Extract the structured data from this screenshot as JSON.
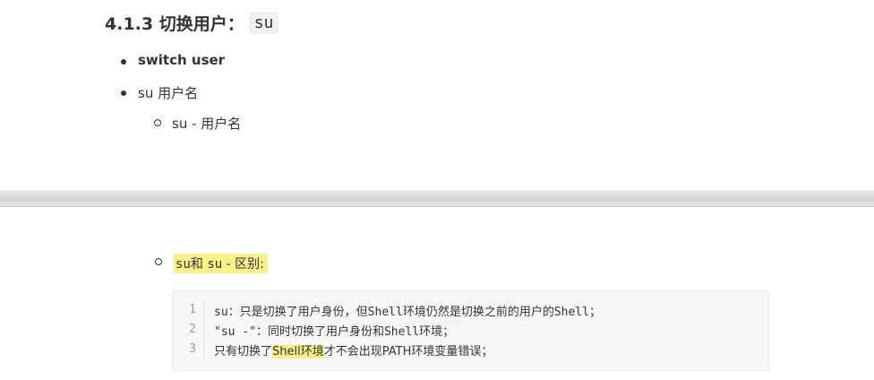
{
  "heading": {
    "text": "4.1.3 切换用户：",
    "code": "su"
  },
  "list": [
    {
      "text": "switch user"
    },
    {
      "text": "su 用户名"
    },
    {
      "text": "su - 用户名"
    }
  ],
  "diff_item": {
    "code1": "su",
    "text1": "和 ",
    "code2": "su",
    "text2": " - 区别:"
  },
  "code_block": {
    "lines": [
      {
        "num": "1",
        "p1": "su",
        "p2": "：只是切换了用户身份，但",
        "p3": "Shell",
        "p4": "环境仍然是切换之前的用户的",
        "p5": "Shell",
        "p6": "；"
      },
      {
        "num": "2",
        "p1": "\"su -\"",
        "p2": "：同时切换了用户身份和",
        "p3": "Shell",
        "p4": "环境；"
      },
      {
        "num": "3",
        "p1": "只有切换了",
        "mark": "Shell环境",
        "p2": "才不会出现PATH环境变量错误；"
      }
    ]
  },
  "colors": {
    "highlight": "#faf08a",
    "text": "#333333",
    "divider": "#d4d4d4"
  }
}
